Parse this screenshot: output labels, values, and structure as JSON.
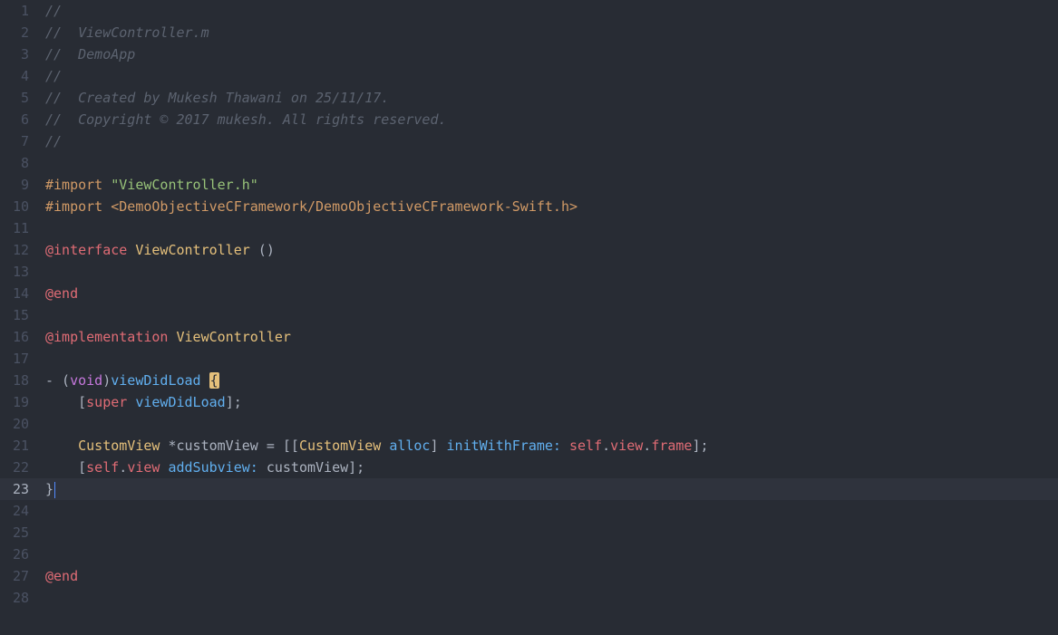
{
  "file": "ViewController.m",
  "currentLine": 23,
  "lines": {
    "l1": {
      "comment": "//"
    },
    "l2": {
      "comment": "//  ViewController.m"
    },
    "l3": {
      "comment": "//  DemoApp"
    },
    "l4": {
      "comment": "//"
    },
    "l5": {
      "comment": "//  Created by Mukesh Thawani on 25/11/17."
    },
    "l6": {
      "comment": "//  Copyright © 2017 mukesh. All rights reserved."
    },
    "l7": {
      "comment": "//"
    },
    "l9": {
      "kw": "#import",
      "str": "\"ViewController.h\""
    },
    "l10": {
      "kw": "#import",
      "inc": "<DemoObjectiveCFramework/DemoObjectiveCFramework-Swift.h>"
    },
    "l12": {
      "kw": "@interface",
      "cls": "ViewController",
      "tail": " ()"
    },
    "l14": {
      "kw": "@end"
    },
    "l16": {
      "kw": "@implementation",
      "cls": "ViewController",
      "tail": ""
    },
    "l18": {
      "dash": "- (",
      "void": "void",
      "close": ")",
      "method": "viewDidLoad",
      "brace": " {"
    },
    "l19": {
      "indent": "    [",
      "super": "super",
      "msg": "viewDidLoad",
      "end": "];"
    },
    "l21": {
      "indent": "    ",
      "type": "CustomView",
      "var": " *customView = [[",
      "type2": "CustomView",
      "alloc": "alloc",
      "mid": "] ",
      "init": "initWithFrame:",
      "sp": " ",
      "self": "self",
      "dot1": ".",
      "view": "view",
      "dot2": ".",
      "frame": "frame",
      "end": "];"
    },
    "l22": {
      "indent": "    [",
      "self": "self",
      "dot": ".",
      "view": "view",
      "msg": "addSubview:",
      "arg": " customView];"
    },
    "l23": {
      "brace": "}"
    },
    "l27": {
      "kw": "@end"
    }
  },
  "gutter": {
    "1": "1",
    "2": "2",
    "3": "3",
    "4": "4",
    "5": "5",
    "6": "6",
    "7": "7",
    "8": "8",
    "9": "9",
    "10": "10",
    "11": "11",
    "12": "12",
    "13": "13",
    "14": "14",
    "15": "15",
    "16": "16",
    "17": "17",
    "18": "18",
    "19": "19",
    "20": "20",
    "21": "21",
    "22": "22",
    "23": "23",
    "24": "24",
    "25": "25",
    "26": "26",
    "27": "27",
    "28": "28"
  }
}
